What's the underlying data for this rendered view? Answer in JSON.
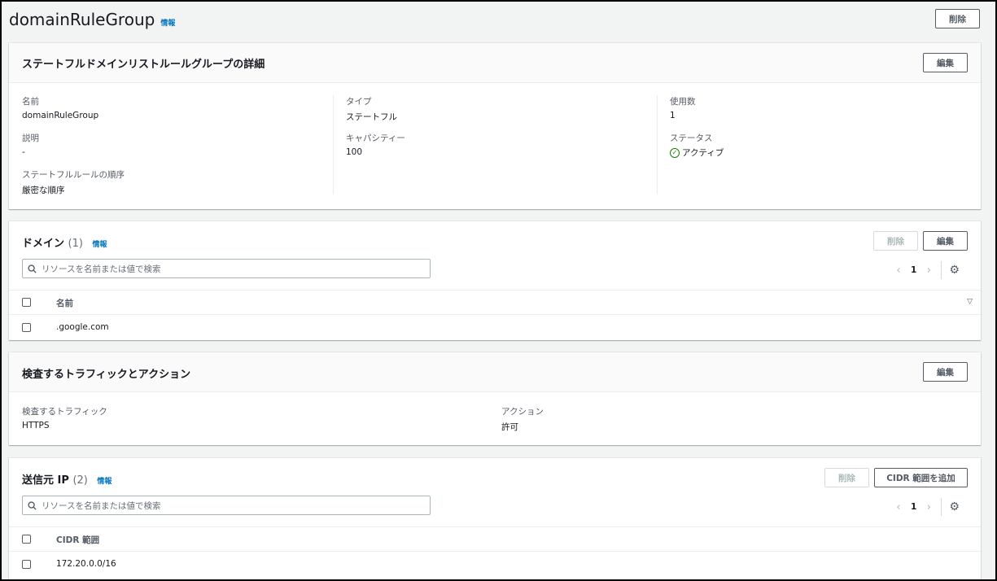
{
  "page": {
    "title": "domainRuleGroup",
    "info": "情報",
    "delete_label": "削除"
  },
  "details": {
    "title": "ステートフルドメインリストルールグループの詳細",
    "edit_label": "編集",
    "name_label": "名前",
    "name_value": "domainRuleGroup",
    "desc_label": "説明",
    "desc_value": "-",
    "order_label": "ステートフルルールの順序",
    "order_value": "厳密な順序",
    "type_label": "タイプ",
    "type_value": "ステートフル",
    "capacity_label": "キャパシティー",
    "capacity_value": "100",
    "usage_label": "使用数",
    "usage_value": "1",
    "status_label": "ステータス",
    "status_value": "アクティブ"
  },
  "domains": {
    "title": "ドメイン",
    "count": "(1)",
    "info": "情報",
    "delete_label": "削除",
    "edit_label": "編集",
    "search_placeholder": "リソースを名前または値で検索",
    "page": "1",
    "column": "名前",
    "rows": [
      ".google.com"
    ]
  },
  "traffic": {
    "title": "検査するトラフィックとアクション",
    "edit_label": "編集",
    "traffic_label": "検査するトラフィック",
    "traffic_value": "HTTPS",
    "action_label": "アクション",
    "action_value": "許可"
  },
  "source_ip": {
    "title": "送信元 IP",
    "count": "(2)",
    "info": "情報",
    "delete_label": "削除",
    "add_label": "CIDR 範囲を追加",
    "search_placeholder": "リソースを名前または値で検索",
    "page": "1",
    "column": "CIDR 範囲",
    "rows": [
      "172.20.0.0/16"
    ]
  },
  "icons": {
    "search": "search-icon",
    "gear": "gear-icon",
    "prev": "chevron-left-icon",
    "next": "chevron-right-icon",
    "status": "check-circle-icon",
    "sort": "sort-down-icon"
  },
  "colors": {
    "link": "#0073bb",
    "success": "#1d8102",
    "border": "#545b64"
  }
}
